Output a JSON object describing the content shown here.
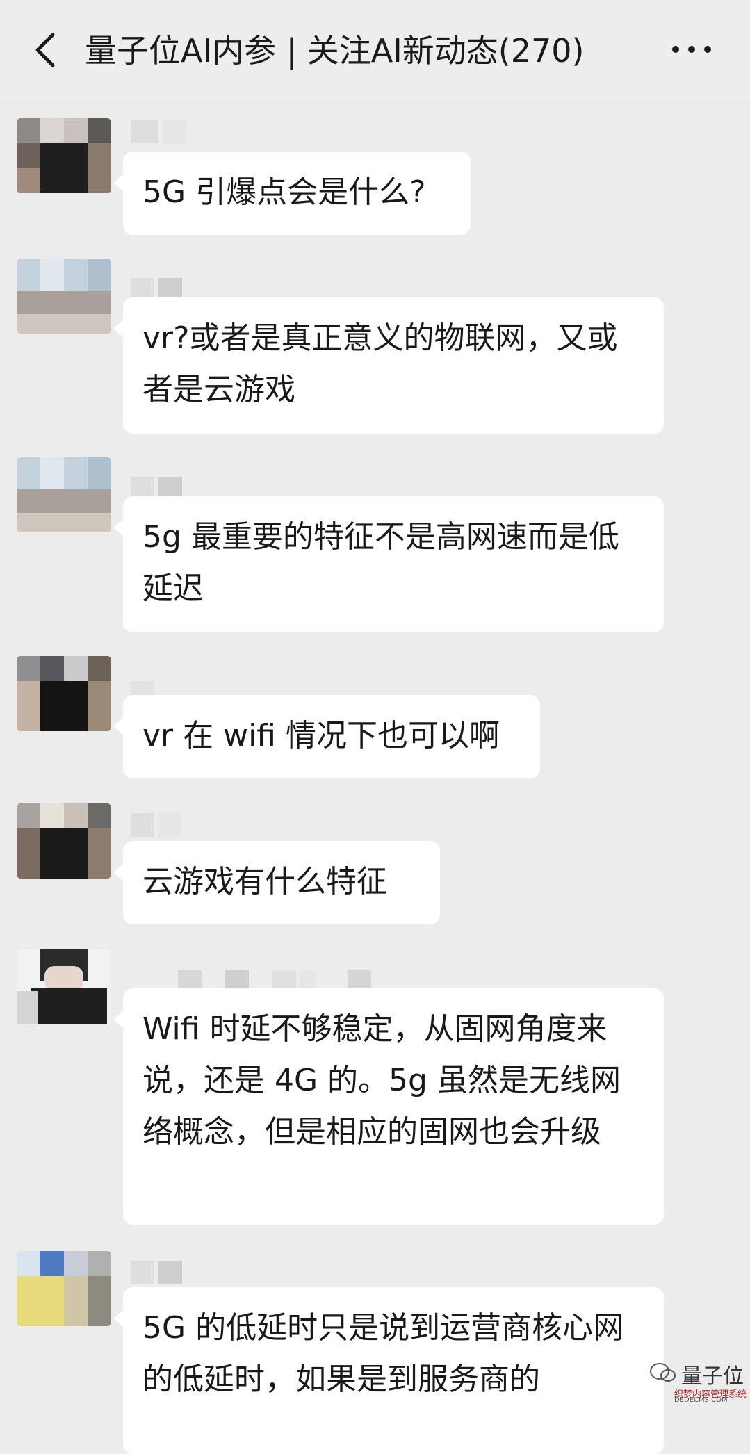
{
  "header": {
    "title": "量子位AI内参 | 关注AI新动态(270)",
    "back_icon": "chevron-left-icon",
    "more_icon": "more-dots-icon"
  },
  "messages": [
    {
      "text": "5G 引爆点会是什么?"
    },
    {
      "text": "vr?或者是真正意义的物联网，又或者是云游戏"
    },
    {
      "text": "5g 最重要的特征不是高网速而是低延迟"
    },
    {
      "text": "vr 在 wifi 情况下也可以啊"
    },
    {
      "text": "云游戏有什么特征"
    },
    {
      "text": "Wifi 时延不够稳定，从固网角度来说，还是 4G 的。5g 虽然是无线网络概念，但是相应的固网也会升级"
    },
    {
      "text": "5G 的低延时只是说到运营商核心网的低延时，如果是到服务商的"
    }
  ],
  "watermark": {
    "brand": "量子位",
    "sub": "织梦内容管理系统",
    "site": "DEDECMS.COM"
  },
  "colors": {
    "background": "#ececec",
    "bubble": "#ffffff",
    "text": "#191919"
  }
}
